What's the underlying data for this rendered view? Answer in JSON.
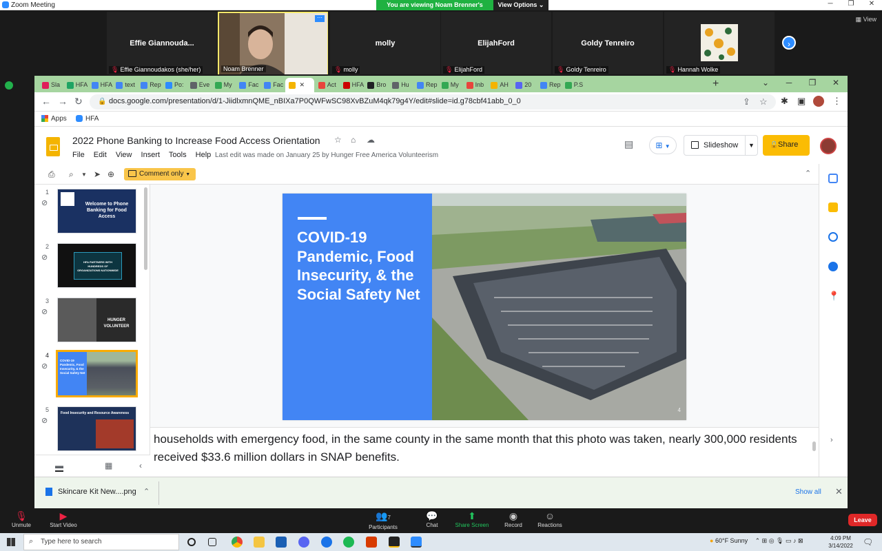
{
  "zoom": {
    "window_title": "Zoom Meeting",
    "viewing_banner": "You are viewing Noam Brenner's screen",
    "view_options": "View Options",
    "view_button": "View",
    "participants": [
      {
        "name": "Effie  Giannouda...",
        "label": "Effie Giannoudakos (she/her)"
      },
      {
        "name": "",
        "label": "Noam Brenner"
      },
      {
        "name": "molly",
        "label": "molly"
      },
      {
        "name": "ElijahFord",
        "label": "ElijahFord"
      },
      {
        "name": "Goldy Tenreiro",
        "label": "Goldy Tenreiro"
      },
      {
        "name": "",
        "label": "Hannah Wolke"
      }
    ],
    "controls": {
      "unmute": "Unmute",
      "start_video": "Start Video",
      "participants": "Participants",
      "participants_count": "7",
      "chat": "Chat",
      "share_screen": "Share Screen",
      "record": "Record",
      "reactions": "Reactions",
      "leave": "Leave"
    }
  },
  "browser": {
    "tabs": [
      "Sla",
      "HFA",
      "HFA",
      "text",
      "Rep",
      "Po:",
      "Eve",
      "My",
      "Fac",
      "Fac",
      "",
      "Act",
      "HFA",
      "Bro",
      "Hu",
      "Rep",
      "My",
      "Inb",
      "AH",
      "20",
      "Rep",
      "P.S"
    ],
    "url": "docs.google.com/presentation/d/1-JiidlxmnQME_nBIXa7P0QWFwSC98XvBZuM4qk79g4Y/edit#slide=id.g78cbf41abb_0_0",
    "bookmarks": [
      "Apps",
      "HFA"
    ]
  },
  "slides": {
    "doc_title": "2022 Phone Banking to Increase Food Access Orientation",
    "menus": [
      "File",
      "Edit",
      "View",
      "Insert",
      "Tools",
      "Help"
    ],
    "last_edit": "Last edit was made on January 25 by Hunger Free America Volunteerism",
    "slideshow": "Slideshow",
    "share": "Share",
    "comment_only": "Comment only",
    "thumbnails": [
      {
        "num": "1",
        "text": "Welcome to Phone Banking for Food Access"
      },
      {
        "num": "2",
        "text": "HFA PARTNERS WITH HUNDREDS OF ORGANIZATIONS NATIONWIDE"
      },
      {
        "num": "3",
        "text": "HUNGER VOLUNTEER"
      },
      {
        "num": "4",
        "text": "COVID-19 Pandemic, Food Insecurity, & the Social Safety Net"
      },
      {
        "num": "5",
        "text": "Food Insecurity and Resource Awareness"
      }
    ],
    "current_slide": {
      "title": "COVID-19 Pandemic, Food Insecurity, & the Social Safety Net",
      "number": "4"
    },
    "speaker_notes": "households with emergency food, in the same county in the same month that this photo was taken, nearly 300,000 residents received $33.6 million dollars in SNAP benefits."
  },
  "downloads": {
    "file": "Skincare Kit New....png",
    "show_all": "Show all"
  },
  "taskbar": {
    "search_placeholder": "Type here to search",
    "weather": "60°F  Sunny",
    "time": "4:09 PM",
    "date": "3/14/2022"
  },
  "colors": {
    "slide_blue": "#4285f4",
    "tab_green": "#a6d5a0",
    "share_yellow": "#fbbc04",
    "zoom_green": "#1fb141",
    "leave_red": "#e02828"
  }
}
